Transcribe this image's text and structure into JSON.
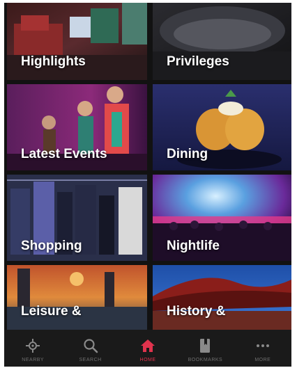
{
  "tiles": [
    {
      "label": "Highlights"
    },
    {
      "label": "Privileges"
    },
    {
      "label": "Latest Events"
    },
    {
      "label": "Dining"
    },
    {
      "label": "Shopping"
    },
    {
      "label": "Nightlife"
    },
    {
      "label": "Leisure &"
    },
    {
      "label": "History &"
    }
  ],
  "tabbar": {
    "tabs": [
      {
        "label": "NEARBY",
        "icon": "nearby-icon"
      },
      {
        "label": "SEARCH",
        "icon": "search-icon"
      },
      {
        "label": "HOME",
        "icon": "home-icon",
        "active": true
      },
      {
        "label": "BOOKMARKS",
        "icon": "bookmark-icon"
      },
      {
        "label": "MORE",
        "icon": "more-icon"
      }
    ],
    "active_color": "#e0334d",
    "inactive_color": "#8a8a8a"
  }
}
